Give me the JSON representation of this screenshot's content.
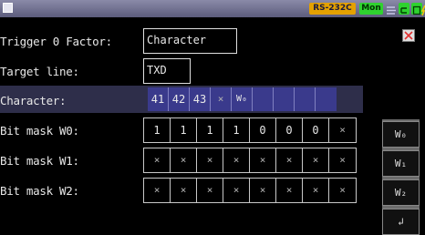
{
  "status": {
    "port": "RS-232C",
    "mode": "Mon"
  },
  "labels": {
    "trigger_factor": "Trigger 0 Factor:",
    "target_line": "Target line:",
    "character": "Character:",
    "mask_w0": "Bit mask W0:",
    "mask_w1": "Bit mask W1:",
    "mask_w2": "Bit mask W2:"
  },
  "values": {
    "trigger_factor": "Character",
    "target_line": "TXD"
  },
  "character_cells": [
    "41",
    "42",
    "43",
    "×",
    "W₀",
    "",
    "",
    "",
    ""
  ],
  "mask_rows": [
    [
      "1",
      "1",
      "1",
      "1",
      "0",
      "0",
      "0",
      "×"
    ],
    [
      "×",
      "×",
      "×",
      "×",
      "×",
      "×",
      "×",
      "×"
    ],
    [
      "×",
      "×",
      "×",
      "×",
      "×",
      "×",
      "×",
      "×"
    ]
  ],
  "side_buttons": [
    "W₀",
    "W₁",
    "W₂",
    "↲"
  ],
  "colors": {
    "status_port": "#e4a100",
    "status_mode": "#2fd22f",
    "char_cell": "#3a3a8c"
  }
}
